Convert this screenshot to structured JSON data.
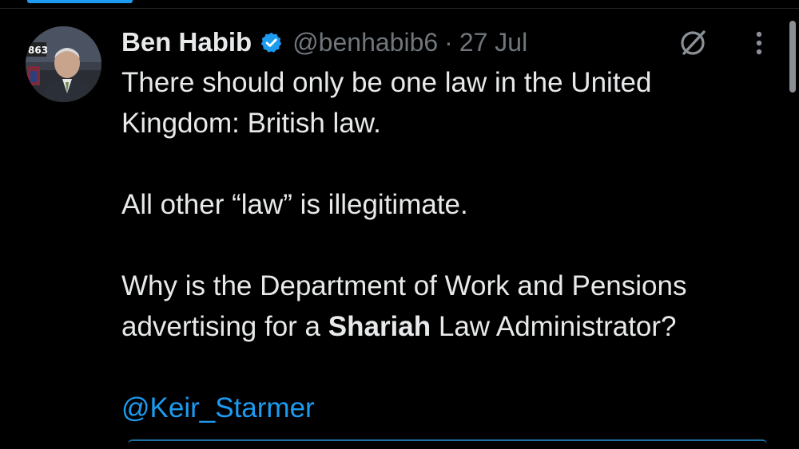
{
  "tweet": {
    "author_name": "Ben Habib",
    "handle": "@benhabib6",
    "separator": "·",
    "date": "27 Jul",
    "avatar_badge": "863",
    "lines": {
      "l1": "There should only be one law in the United",
      "l2": "Kingdom: British law.",
      "l3": "All other “law” is illegitimate.",
      "l4": "Why is the Department of Work and Pensions",
      "l5_pre": "advertising for a ",
      "l5_bold": "Shariah",
      "l5_post": " Law Administrator?"
    },
    "mention": "@Keir_Starmer"
  },
  "icons": {
    "verified": "verified-badge-icon",
    "grok": "grok-icon",
    "more": "more-vertical-icon"
  },
  "colors": {
    "background": "#000000",
    "text": "#e7e9ea",
    "muted": "#71767b",
    "accent": "#1d9bf0"
  }
}
